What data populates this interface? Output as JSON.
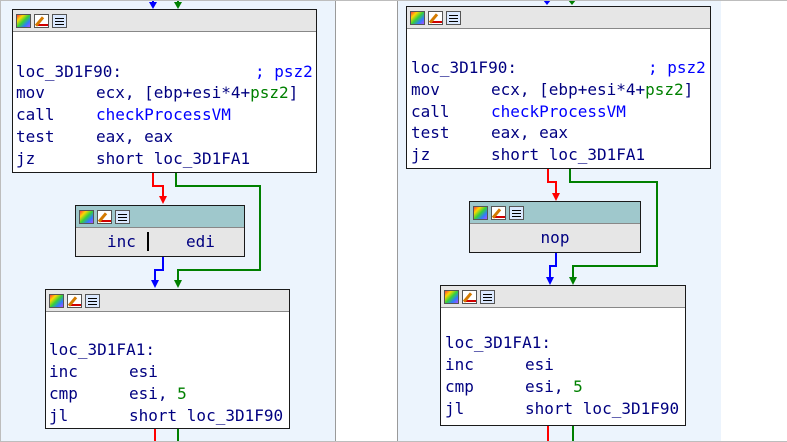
{
  "left": {
    "block1": {
      "label": "loc_3D1F90:",
      "comment": "; psz2",
      "rows": [
        {
          "mn": "mov",
          "a": "ecx, [ebp+esi*4+",
          "b": "psz2",
          "c": "]"
        },
        {
          "mn": "call",
          "a": "checkProcessVM"
        },
        {
          "mn": "test",
          "a": "eax, eax"
        },
        {
          "mn": "jz",
          "a": "short loc_3D1FA1"
        }
      ]
    },
    "block2": {
      "mn": "inc",
      "op": "edi"
    },
    "block3": {
      "label": "loc_3D1FA1:",
      "rows": [
        {
          "mn": "inc",
          "a": "esi"
        },
        {
          "mn": "cmp",
          "a": "esi, ",
          "num": "5"
        },
        {
          "mn": "jl",
          "a": "short loc_3D1F90"
        }
      ]
    }
  },
  "right": {
    "block1": {
      "label": "loc_3D1F90:",
      "comment": "; psz2",
      "rows": [
        {
          "mn": "mov",
          "a": "ecx, [ebp+esi*4+",
          "b": "psz2",
          "c": "]"
        },
        {
          "mn": "call",
          "a": "checkProcessVM"
        },
        {
          "mn": "test",
          "a": "eax, eax"
        },
        {
          "mn": "jz",
          "a": "short loc_3D1FA1"
        }
      ]
    },
    "block2": {
      "mn": "nop"
    },
    "block3": {
      "label": "loc_3D1FA1:",
      "rows": [
        {
          "mn": "inc",
          "a": "esi"
        },
        {
          "mn": "cmp",
          "a": "esi, ",
          "num": "5"
        },
        {
          "mn": "jl",
          "a": "short loc_3D1F90"
        }
      ]
    }
  },
  "icons": [
    "graph-overview-icon",
    "edit-node-icon",
    "text-view-icon"
  ],
  "colors": {
    "graph_bg": "#ecf4fd",
    "edge_true": "#008000",
    "edge_false": "#ff0000",
    "edge_normal": "#0000ff",
    "node_header": "#e6e6e6",
    "node_header_selected": "#9fc8cc",
    "separator": "#9a9a9a"
  }
}
